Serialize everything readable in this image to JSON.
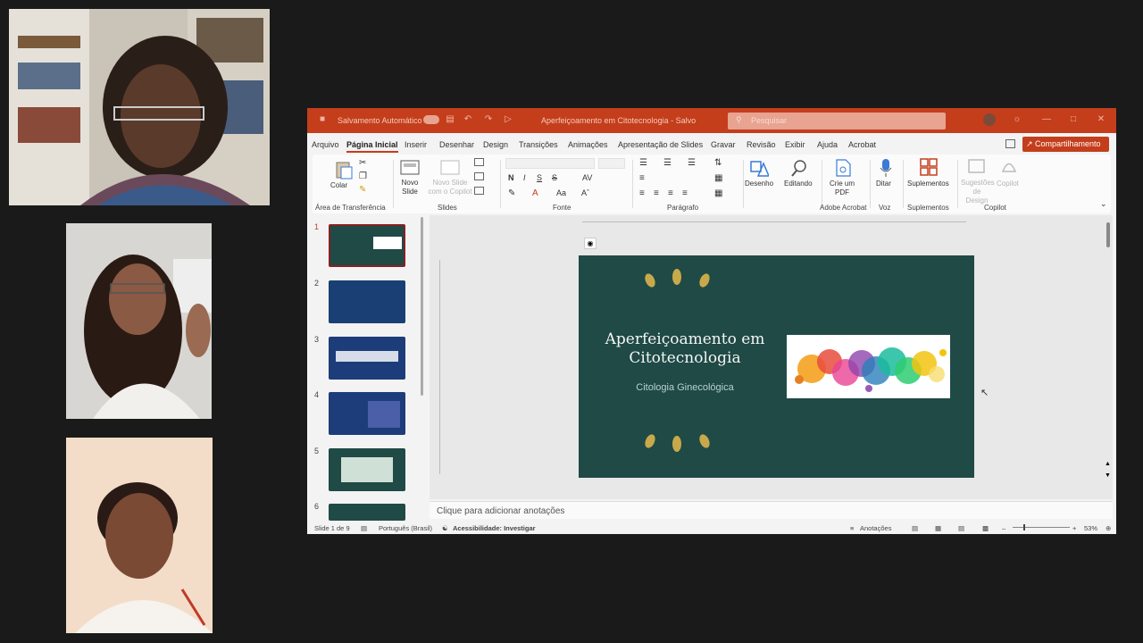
{
  "window": {
    "autosave": "Salvamento Automático",
    "title": "Aperfeiçoamento em Citotecnologia - Salvo",
    "search_placeholder": "Pesquisar"
  },
  "tabs": [
    "Arquivo",
    "Página Inicial",
    "Inserir",
    "Desenhar",
    "Design",
    "Transições",
    "Animações",
    "Apresentação de Slides",
    "Gravar",
    "Revisão",
    "Exibir",
    "Ajuda",
    "Acrobat"
  ],
  "active_tab": "Página Inicial",
  "share_label": "Compartilhamento",
  "ribbon": {
    "groups": {
      "clipboard": "Área de Transferência",
      "slides": "Slides",
      "font": "Fonte",
      "paragraph": "Parágrafo",
      "adobe": "Adobe Acrobat",
      "voice": "Voz",
      "addins": "Suplementos",
      "copilot": "Copilot"
    },
    "buttons": {
      "paste": "Colar",
      "new_slide": "Novo Slide",
      "new_slide_copilot": "Novo Slide com o Copilot",
      "drawing": "Desenho",
      "editing": "Editando",
      "create_pdf": "Crie um PDF",
      "dictate": "Ditar",
      "addins": "Suplementos",
      "design_suggestions": "Sugestões de Design",
      "copilot": "Copilot"
    }
  },
  "slide": {
    "title": "Aperfeiçoamento em Citotecnologia",
    "subtitle": "Citologia Ginecológica"
  },
  "thumbnails": [
    "1",
    "2",
    "3",
    "4",
    "5",
    "6"
  ],
  "notes_placeholder": "Clique para adicionar anotações",
  "status": {
    "slide_counter": "Slide 1 de 9",
    "language": "Português (Brasil)",
    "accessibility": "Acessibilidade: Investigar",
    "notes": "Anotações",
    "zoom": "53%"
  },
  "colors": {
    "accent": "#c43e1c",
    "slide_bg": "#1f4a46"
  }
}
